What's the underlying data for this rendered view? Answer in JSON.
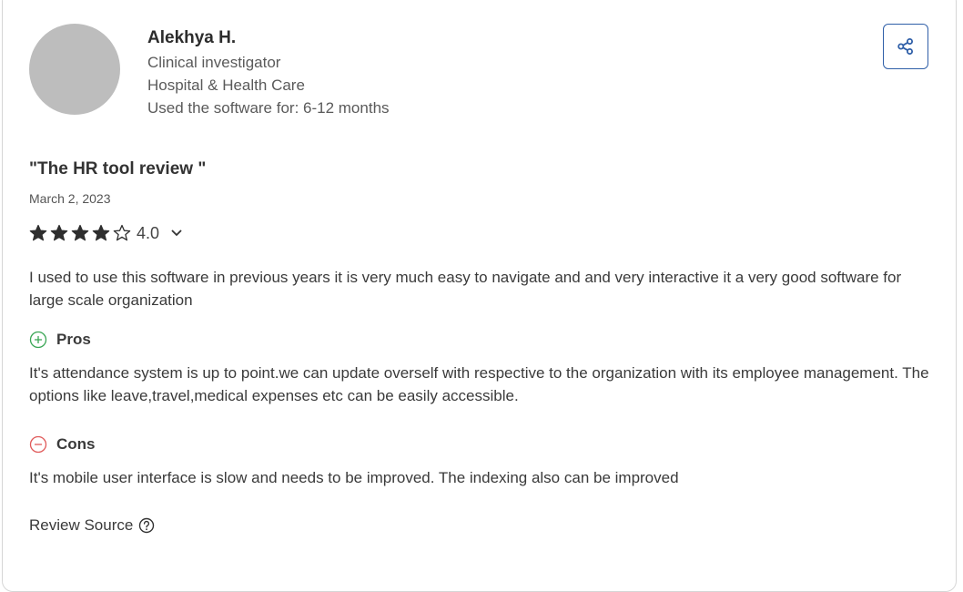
{
  "reviewer": {
    "name": "Alekhya H.",
    "role": "Clinical investigator",
    "industry": "Hospital & Health Care",
    "usage": "Used the software for: 6-12 months"
  },
  "review": {
    "title": "\"The HR tool review \"",
    "date": "March 2, 2023",
    "rating": 4,
    "rating_label": "4.0",
    "max_rating": 5,
    "summary": "I used to use this software in previous years it is very much easy to navigate and and very interactive it a very good software for large scale organization",
    "pros_label": "Pros",
    "pros": "It's attendance system is up to point.we can update overself with respective to the organization with its employee management. The options like leave,travel,medical expenses etc can be easily accessible.",
    "cons_label": "Cons",
    "cons": "It's mobile user interface is slow and needs to be improved. The indexing also can be improved",
    "source_label": "Review Source"
  },
  "icons": {
    "share": "share-icon",
    "star_filled": "star-filled-icon",
    "star_empty": "star-outline-icon",
    "chevron": "chevron-down-icon",
    "pros": "plus-circle-icon",
    "cons": "minus-circle-icon",
    "help": "question-circle-icon"
  },
  "colors": {
    "accent": "#2f5fa8",
    "pros": "#3aa655",
    "cons": "#e05a5a",
    "star": "#2e2e2e",
    "avatar": "#bdbdbd"
  }
}
